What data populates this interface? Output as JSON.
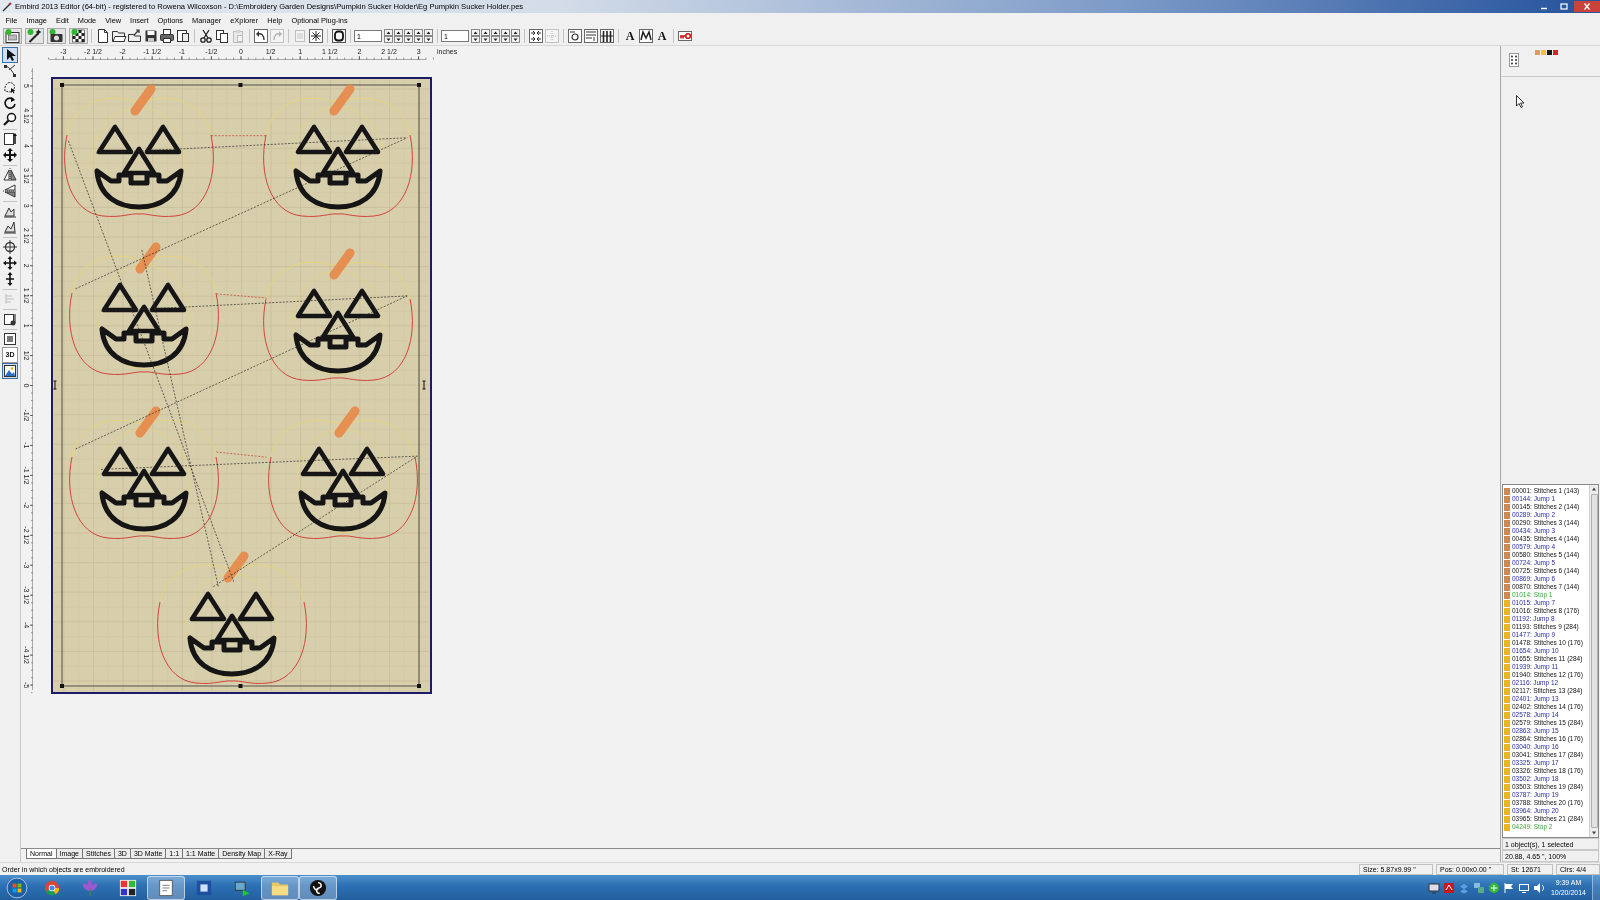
{
  "window": {
    "title": "Embird 2013 Editor (64-bit) - registered to Rowena Wilcoxson - D:\\Embroidery Garden Designs\\Pumpkin Sucker Holder\\Eg Pumpkin Sucker Holder.pes"
  },
  "menu": [
    "File",
    "Image",
    "Edit",
    "Mode",
    "View",
    "Insert",
    "Options",
    "Manager",
    "eXplorer",
    "Help",
    "Optional Plug-ins"
  ],
  "toolbar": {
    "groups": [
      [
        {
          "kind": "button",
          "disabled": false
        },
        {
          "kind": "button",
          "disabled": false
        },
        {
          "kind": "button",
          "disabled": false
        },
        {
          "kind": "button",
          "disabled": false
        }
      ],
      [
        {
          "kind": "button",
          "disabled": false
        },
        {
          "kind": "button",
          "disabled": false
        },
        {
          "kind": "button",
          "disabled": false
        },
        {
          "kind": "button",
          "disabled": false
        },
        {
          "kind": "button",
          "disabled": false
        },
        {
          "kind": "button",
          "disabled": false
        }
      ],
      [
        {
          "kind": "button",
          "disabled": false
        },
        {
          "kind": "button",
          "disabled": false
        },
        {
          "kind": "button",
          "disabled": true
        }
      ],
      [
        {
          "kind": "button",
          "disabled": false
        },
        {
          "kind": "button",
          "disabled": true
        }
      ],
      [
        {
          "kind": "button",
          "disabled": true
        },
        {
          "kind": "button",
          "disabled": false
        }
      ],
      [
        {
          "kind": "button",
          "disabled": false
        }
      ],
      [
        {
          "kind": "field",
          "value": "1"
        }
      ],
      [
        {
          "kind": "field",
          "value": "1"
        }
      ],
      [
        {
          "kind": "button",
          "disabled": false
        },
        {
          "kind": "button",
          "disabled": true
        }
      ],
      [
        {
          "kind": "button",
          "disabled": false
        },
        {
          "kind": "button",
          "disabled": false
        },
        {
          "kind": "button",
          "disabled": false
        }
      ],
      [
        {
          "kind": "text",
          "label": "A",
          "disabled": false
        },
        {
          "kind": "button",
          "disabled": false
        },
        {
          "kind": "text",
          "label": "A",
          "disabled": false
        }
      ],
      [
        {
          "kind": "button",
          "disabled": false
        }
      ]
    ]
  },
  "left_toolbar": {
    "groups": [
      [
        {
          "kind": "button",
          "selected": true,
          "disabled": false
        },
        {
          "kind": "button",
          "selected": false,
          "disabled": false
        },
        {
          "kind": "button",
          "selected": false,
          "disabled": false
        },
        {
          "kind": "button",
          "selected": false,
          "disabled": false
        },
        {
          "kind": "button",
          "selected": false,
          "disabled": false
        }
      ],
      [
        {
          "kind": "button",
          "selected": false,
          "disabled": false
        },
        {
          "kind": "button",
          "selected": false,
          "disabled": false
        }
      ],
      [
        {
          "kind": "button",
          "selected": false,
          "disabled": false
        },
        {
          "kind": "button",
          "selected": false,
          "disabled": false
        }
      ],
      [
        {
          "kind": "button",
          "selected": false,
          "disabled": false
        },
        {
          "kind": "button",
          "selected": false,
          "disabled": false
        }
      ],
      [
        {
          "kind": "button",
          "selected": false,
          "disabled": false
        },
        {
          "kind": "button",
          "selected": false,
          "disabled": false
        },
        {
          "kind": "button",
          "selected": false,
          "disabled": false
        }
      ],
      [
        {
          "kind": "button",
          "selected": false,
          "disabled": true
        }
      ],
      [
        {
          "kind": "button",
          "selected": false,
          "disabled": false
        }
      ],
      [
        {
          "kind": "button",
          "selected": false,
          "disabled": false
        },
        {
          "kind": "text",
          "label": "3D",
          "selected": false,
          "disabled": false
        },
        {
          "kind": "button",
          "selected": true,
          "disabled": false
        }
      ]
    ]
  },
  "ruler": {
    "horizontal": [
      "-3",
      "-2 1/2",
      "-2",
      "-1 1/2",
      "-1",
      "-1/2",
      "0",
      "1/2",
      "1",
      "1 1/2",
      "2",
      "2 1/2",
      "3"
    ],
    "unit": "inches",
    "vertical": [
      "5",
      "4 1/2",
      "4",
      "3 1/2",
      "3",
      "2 1/2",
      "2",
      "1 1/2",
      "1",
      "1/2",
      "0",
      "-1/2",
      "-1",
      "-1 1/2",
      "-2",
      "-2 1/2",
      "-3",
      "-3 1/2",
      "-4",
      "-4 1/2",
      "-5"
    ]
  },
  "thread_colors": [
    {
      "color": "#e59a5c"
    },
    {
      "color": "#f0c23a"
    },
    {
      "color": "#1a1a1a"
    },
    {
      "color": "#d02828"
    }
  ],
  "stitch_list": [
    {
      "text": "00001: Stitches 1 (143)",
      "kind": "stitches",
      "color": "#c98a57"
    },
    {
      "text": "00144: Jump 1",
      "kind": "jump",
      "color": "#c98a57"
    },
    {
      "text": "00145: Stitches 2 (144)",
      "kind": "stitches",
      "color": "#c98a57"
    },
    {
      "text": "00289: Jump 2",
      "kind": "jump",
      "color": "#c98a57"
    },
    {
      "text": "00290: Stitches 3 (144)",
      "kind": "stitches",
      "color": "#c98a57"
    },
    {
      "text": "00434: Jump 3",
      "kind": "jump",
      "color": "#c98a57"
    },
    {
      "text": "00435: Stitches 4 (144)",
      "kind": "stitches",
      "color": "#c98a57"
    },
    {
      "text": "00579: Jump 4",
      "kind": "jump",
      "color": "#c98a57"
    },
    {
      "text": "00580: Stitches 5 (144)",
      "kind": "stitches",
      "color": "#c98a57"
    },
    {
      "text": "00724: Jump 5",
      "kind": "jump",
      "color": "#c98a57"
    },
    {
      "text": "00725: Stitches 6 (144)",
      "kind": "stitches",
      "color": "#c98a57"
    },
    {
      "text": "00869: Jump 6",
      "kind": "jump",
      "color": "#c98a57"
    },
    {
      "text": "00870: Stitches 7 (144)",
      "kind": "stitches",
      "color": "#c98a57"
    },
    {
      "text": "01014: Stop 1",
      "kind": "stop",
      "color": "#c98a57"
    },
    {
      "text": "01015: Jump 7",
      "kind": "jump",
      "color": "#e8b824"
    },
    {
      "text": "01016: Stitches 8 (176)",
      "kind": "stitches",
      "color": "#e8b824"
    },
    {
      "text": "01192: Jump 8",
      "kind": "jump",
      "color": "#e8b824"
    },
    {
      "text": "01193: Stitches 9 (284)",
      "kind": "stitches",
      "color": "#e8b824"
    },
    {
      "text": "01477: Jump 9",
      "kind": "jump",
      "color": "#e8b824"
    },
    {
      "text": "01478: Stitches 10 (176)",
      "kind": "stitches",
      "color": "#e8b824"
    },
    {
      "text": "01654: Jump 10",
      "kind": "jump",
      "color": "#e8b824"
    },
    {
      "text": "01655: Stitches 11 (284)",
      "kind": "stitches",
      "color": "#e8b824"
    },
    {
      "text": "01939: Jump 11",
      "kind": "jump",
      "color": "#e8b824"
    },
    {
      "text": "01940: Stitches 12 (176)",
      "kind": "stitches",
      "color": "#e8b824"
    },
    {
      "text": "02116: Jump 12",
      "kind": "jump",
      "color": "#e8b824"
    },
    {
      "text": "02117: Stitches 13 (284)",
      "kind": "stitches",
      "color": "#e8b824"
    },
    {
      "text": "02401: Jump 13",
      "kind": "jump",
      "color": "#e8b824"
    },
    {
      "text": "02402: Stitches 14 (176)",
      "kind": "stitches",
      "color": "#e8b824"
    },
    {
      "text": "02578: Jump 14",
      "kind": "jump",
      "color": "#e8b824"
    },
    {
      "text": "02579: Stitches 15 (284)",
      "kind": "stitches",
      "color": "#e8b824"
    },
    {
      "text": "02863: Jump 15",
      "kind": "jump",
      "color": "#e8b824"
    },
    {
      "text": "02864: Stitches 16 (176)",
      "kind": "stitches",
      "color": "#e8b824"
    },
    {
      "text": "03040: Jump 16",
      "kind": "jump",
      "color": "#e8b824"
    },
    {
      "text": "03041: Stitches 17 (284)",
      "kind": "stitches",
      "color": "#e8b824"
    },
    {
      "text": "03325: Jump 17",
      "kind": "jump",
      "color": "#e8b824"
    },
    {
      "text": "03326: Stitches 18 (176)",
      "kind": "stitches",
      "color": "#e8b824"
    },
    {
      "text": "03502: Jump 18",
      "kind": "jump",
      "color": "#e8b824"
    },
    {
      "text": "03503: Stitches 19 (284)",
      "kind": "stitches",
      "color": "#e8b824"
    },
    {
      "text": "03787: Jump 19",
      "kind": "jump",
      "color": "#e8b824"
    },
    {
      "text": "03788: Stitches 20 (176)",
      "kind": "stitches",
      "color": "#e8b824"
    },
    {
      "text": "03964: Jump 20",
      "kind": "jump",
      "color": "#e8b824"
    },
    {
      "text": "03965: Stitches 21 (284)",
      "kind": "stitches",
      "color": "#e8b824"
    },
    {
      "text": "04249: Stop 2",
      "kind": "stop",
      "color": "#e8b824"
    }
  ],
  "selection_info": [
    "1 object(s), 1 selected",
    "20.88, 4.65 \", 100%"
  ],
  "view_tabs": [
    {
      "label": "Normal",
      "selected": true
    },
    {
      "label": "Image",
      "selected": false
    },
    {
      "label": "Stitches",
      "selected": false
    },
    {
      "label": "3D",
      "selected": false
    },
    {
      "label": "3D Matte",
      "selected": false
    },
    {
      "label": "1:1",
      "selected": false
    },
    {
      "label": "1:1 Matte",
      "selected": false
    },
    {
      "label": "Density Map",
      "selected": false
    },
    {
      "label": "X-Ray",
      "selected": false
    }
  ],
  "status_bar": {
    "message": "Order in which objects are embroidered",
    "fields": [
      "Size: 5.87x9.99 \"",
      "Pos: 0.00x0.00 \"",
      "St: 12671",
      "Clrs: 4/4"
    ]
  },
  "taskbar": {
    "apps": [
      {
        "running": false
      },
      {
        "running": false
      },
      {
        "running": false
      },
      {
        "running": true
      },
      {
        "running": false
      },
      {
        "running": false
      },
      {
        "running": true
      },
      {
        "running": true
      }
    ],
    "time": "9:39 AM",
    "date": "10/20/2014"
  }
}
